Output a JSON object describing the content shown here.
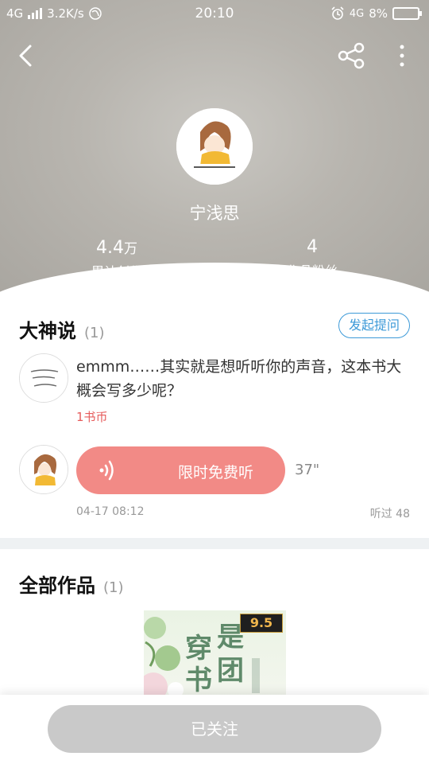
{
  "status_bar": {
    "network": "4G",
    "speed": "3.2K/s",
    "time": "20:10",
    "network_right": "4G",
    "battery": "8%"
  },
  "header": {
    "author_name": "宁浅思",
    "stats": {
      "works_num": "4.4",
      "works_unit": "万",
      "works_label": "累计创作",
      "fans_num": "4",
      "fans_label": "作品粉丝"
    }
  },
  "questions": {
    "title": "大神说",
    "count": "(1)",
    "ask_button": "发起提问",
    "item": {
      "question": "emmm……其实就是想听听你的声音，这本书大概会写多少呢？",
      "reward": "1书币",
      "voice_label": "限时免费听",
      "duration": "37\"",
      "date": "04-17 08:12",
      "listens": "听过 48"
    }
  },
  "works": {
    "title": "全部作品",
    "count": "(1)",
    "book": {
      "rating": "9.5",
      "title_chars": [
        "穿",
        "书",
        "是",
        "团"
      ]
    }
  },
  "follow_button": "已关注",
  "colors": {
    "accent_blue": "#3d9ad8",
    "voice_pink": "#f28a86",
    "reward_red": "#e65c5c",
    "follow_gray": "#c9c9c9"
  }
}
